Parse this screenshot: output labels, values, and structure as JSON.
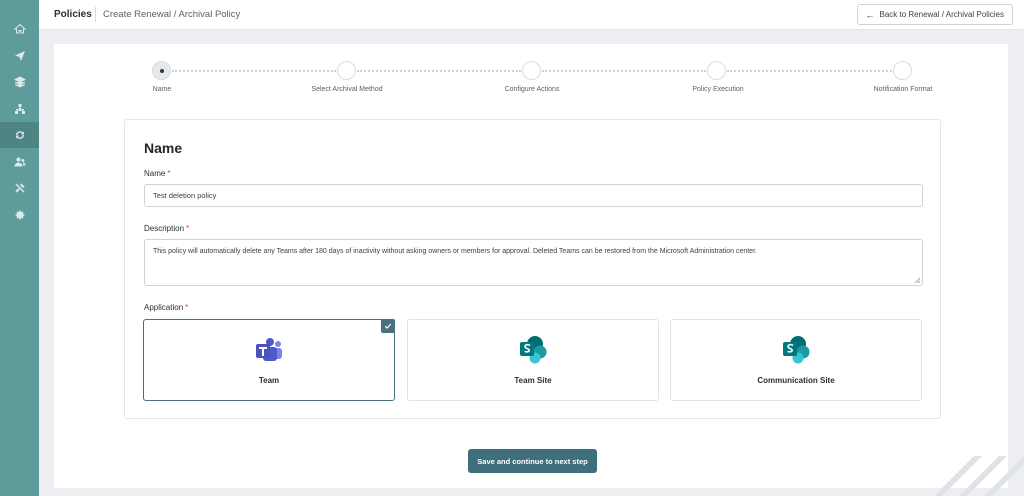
{
  "sidebar": {
    "items": [
      {
        "icon": "home-icon",
        "active": false
      },
      {
        "icon": "paper-plane-icon",
        "active": false
      },
      {
        "icon": "layers-icon",
        "active": false
      },
      {
        "icon": "hierarchy-icon",
        "active": false
      },
      {
        "icon": "sync-icon",
        "active": true
      },
      {
        "icon": "users-icon",
        "active": false
      },
      {
        "icon": "tools-icon",
        "active": false
      },
      {
        "icon": "gear-icon",
        "active": false
      }
    ]
  },
  "header": {
    "breadcrumb_root": "Policies",
    "breadcrumb_current": "Create Renewal / Archival Policy",
    "back_button": "Back to Renewal / Archival Policies"
  },
  "stepper": {
    "steps": [
      {
        "label": "Name",
        "active": true
      },
      {
        "label": "Select Archival Method",
        "active": false
      },
      {
        "label": "Configure Actions",
        "active": false
      },
      {
        "label": "Policy Execution",
        "active": false
      },
      {
        "label": "Notification Format",
        "active": false
      }
    ]
  },
  "form": {
    "title": "Name",
    "name_label": "Name",
    "name_value": "Test deletion policy",
    "description_label": "Description",
    "description_value": "This policy will automatically delete any Teams after 180 days of inactivity without asking owners or members for approval. Deleted Teams can be restored from the Microsoft Administration center.",
    "application_label": "Application",
    "required_mark": "*",
    "applications": [
      {
        "label": "Team",
        "icon": "teams-icon",
        "selected": true
      },
      {
        "label": "Team Site",
        "icon": "sharepoint-icon",
        "selected": false
      },
      {
        "label": "Communication Site",
        "icon": "sharepoint-icon",
        "selected": false
      }
    ]
  },
  "actions": {
    "continue_button": "Save and continue to next step"
  },
  "colors": {
    "sidebar": "#5e9c9b",
    "accent": "#3f6f7c",
    "required": "#e0443e"
  }
}
